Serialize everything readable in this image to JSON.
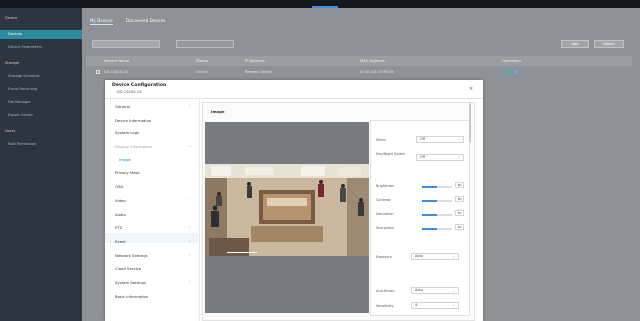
{
  "sidebar": {
    "items": [
      {
        "label": "Device",
        "group": true
      },
      {
        "label": "Devices",
        "active": true
      },
      {
        "label": "Device Parameters"
      },
      {
        "label": "Storage",
        "group": true
      },
      {
        "label": "Storage Schedule"
      },
      {
        "label": "Event Recording"
      },
      {
        "label": "File Manager"
      },
      {
        "label": "Export Center"
      },
      {
        "label": "Users",
        "group": true
      },
      {
        "label": "Role Permission"
      }
    ]
  },
  "tabs": [
    "My Devices",
    "Discovered Devices"
  ],
  "device_table": {
    "columns": [
      "Device Name",
      "Status",
      "IP Address",
      "MAC Address",
      "Operation"
    ],
    "row": {
      "name": "DS-CS400-1X",
      "status": "Online",
      "ip": "Remote Device",
      "mac": "00:0C:43:72:6E:35"
    }
  },
  "toolbar": {
    "add_label": "Add",
    "delete_label": "Delete"
  },
  "colors": {
    "accent": "#2a8c9c",
    "sidebar": "#2d3540",
    "link": "#1f7fd6"
  },
  "modal": {
    "title": "Device Configuration",
    "subtitle": "DS-CS400-1X",
    "close": "×",
    "menu": [
      {
        "label": "General",
        "expandable": true
      },
      {
        "label": "Device Information"
      },
      {
        "label": "System Logs"
      },
      {
        "label": "Display Information",
        "expandable": true,
        "dim": true
      },
      {
        "label": "Image",
        "selected": true
      },
      {
        "label": "Privacy Mask"
      },
      {
        "label": "OSD"
      },
      {
        "label": "Video",
        "expandable": true
      },
      {
        "label": "Audio"
      },
      {
        "label": "PTZ",
        "expandable": true
      },
      {
        "label": "Event",
        "expandable": true
      },
      {
        "label": "Network Settings",
        "expandable": true
      },
      {
        "label": "Cloud Service"
      },
      {
        "label": "System Settings",
        "expandable": true
      },
      {
        "label": "Basic Information"
      }
    ],
    "panel_title": "Image",
    "controls": {
      "mirror": {
        "label": "Mirror",
        "value": "Off"
      },
      "daynight": {
        "label": "Day/Night Switch",
        "value": "Off"
      },
      "brightness": {
        "label": "Brightness",
        "value": "50",
        "level": 50
      },
      "contrast": {
        "label": "Contrast",
        "value": "50",
        "level": 50
      },
      "saturation": {
        "label": "Saturation",
        "value": "50",
        "level": 50
      },
      "sharpness": {
        "label": "Sharpness",
        "value": "50",
        "level": 50
      },
      "exposure": {
        "label": "Exposure",
        "value": "Auto"
      },
      "antiflicker": {
        "label": "Anti-flicker",
        "value": "Auto"
      },
      "sensitivity": {
        "label": "Sensitivity",
        "value": "4"
      }
    }
  }
}
